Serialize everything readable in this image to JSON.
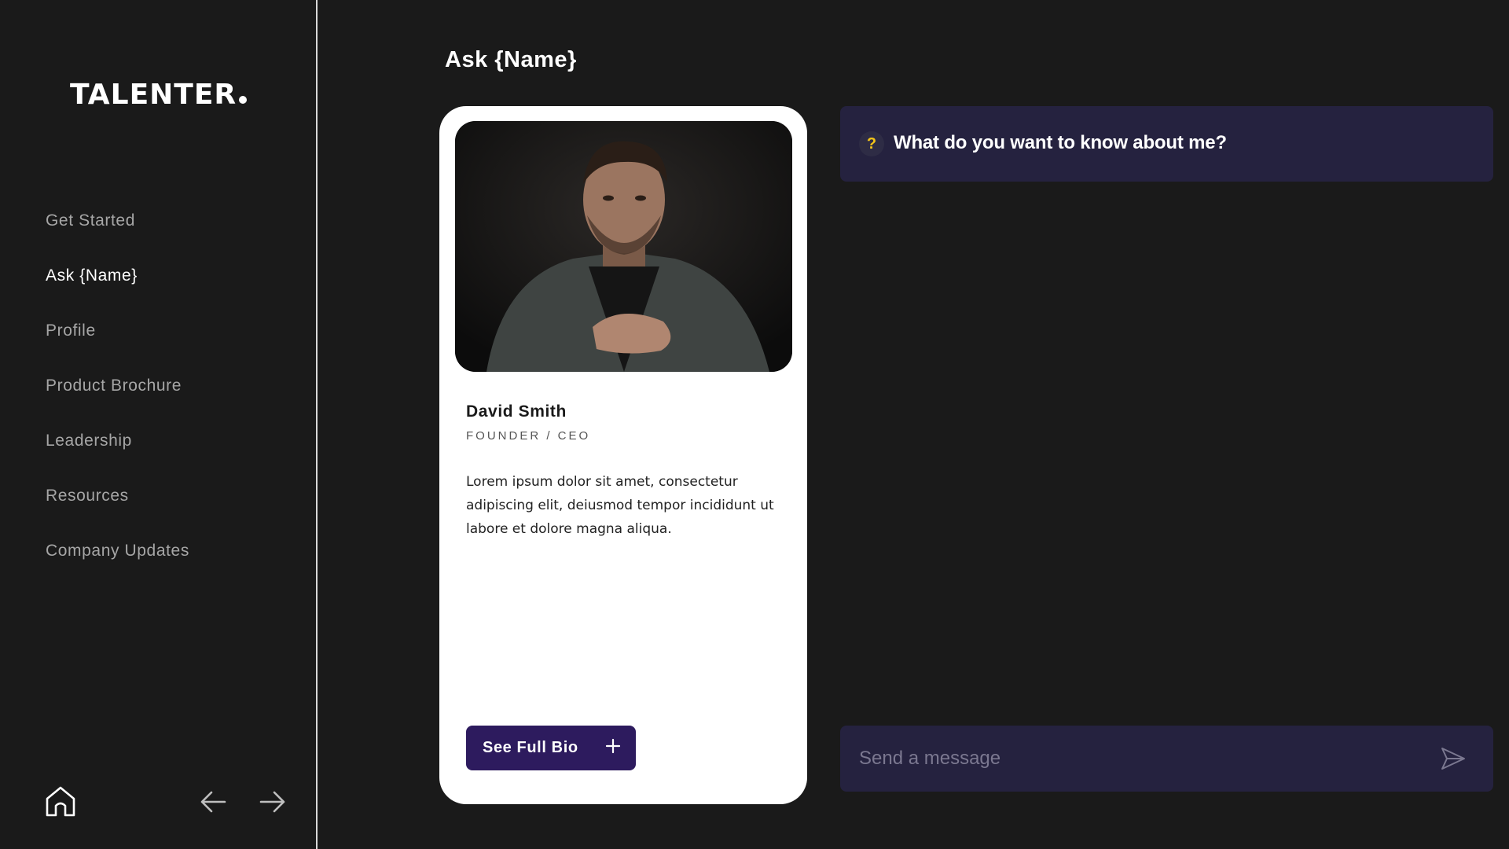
{
  "app": {
    "logo": "TALENTER"
  },
  "sidebar": {
    "items": [
      {
        "label": "Get Started",
        "active": false
      },
      {
        "label": "Ask {Name}",
        "active": true
      },
      {
        "label": "Profile",
        "active": false
      },
      {
        "label": "Product Brochure",
        "active": false
      },
      {
        "label": "Leadership",
        "active": false
      },
      {
        "label": "Resources",
        "active": false
      },
      {
        "label": "Company Updates",
        "active": false
      }
    ],
    "footer_icons": [
      "home-icon",
      "arrow-left-icon",
      "arrow-right-icon"
    ]
  },
  "main": {
    "title": "Ask {Name}",
    "card": {
      "name": "David Smith",
      "role": "FOUNDER / CEO",
      "bio": "Lorem ipsum dolor sit amet, consectetur adipiscing elit,  deiusmod tempor incididunt ut labore et dolore magna aliqua.",
      "button_label": "See Full Bio",
      "button_icon": "plus-icon"
    },
    "question": {
      "icon": "?",
      "text": "What do you want to know about me?"
    },
    "message": {
      "placeholder": "Send a message",
      "send_icon": "send-icon"
    }
  },
  "colors": {
    "background": "#1a1a1a",
    "panel": "#25223f",
    "button": "#2d1b5e",
    "accent_question": "#f5c518",
    "nav_inactive": "#a6a6a6"
  }
}
